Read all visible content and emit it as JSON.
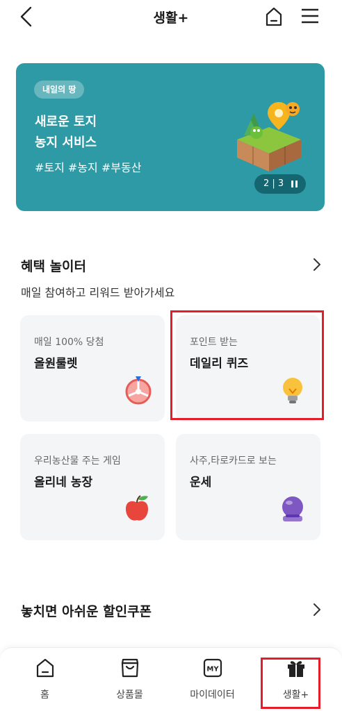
{
  "header": {
    "title": "생활+",
    "back_icon": "chevron-left-icon",
    "home_icon": "home-icon",
    "menu_icon": "hamburger-menu-icon"
  },
  "banner": {
    "badge": "내일의 땅",
    "line1": "새로운 토지",
    "line2": "농지 서비스",
    "tags": "#토지 #농지 #부동산",
    "counter": "2 | 3",
    "background_color": "#2e9aa5"
  },
  "benefits": {
    "title": "혜택 놀이터",
    "subtitle": "매일 참여하고 리워드 받아가세요",
    "cards": [
      {
        "sub": "매일 100% 당첨",
        "title": "올원룰렛",
        "icon": "roulette-icon"
      },
      {
        "sub": "포인트 받는",
        "title": "데일리 퀴즈",
        "icon": "lightbulb-icon"
      },
      {
        "sub": "우리농산물 주는 게임",
        "title": "올리네 농장",
        "icon": "apple-icon"
      },
      {
        "sub": "사주,타로카드로 보는",
        "title": "운세",
        "icon": "crystal-ball-icon"
      }
    ]
  },
  "coupons": {
    "title": "놓치면 아쉬운 할인쿠폰"
  },
  "bottom_nav": {
    "items": [
      {
        "label": "홈",
        "icon": "home-icon"
      },
      {
        "label": "상품몰",
        "icon": "shopping-bag-icon"
      },
      {
        "label": "마이데이터",
        "icon": "mydata-icon",
        "icon_text": "MY"
      },
      {
        "label": "생활+",
        "icon": "gift-icon"
      }
    ]
  },
  "colors": {
    "accent_teal": "#2e9aa5",
    "highlight_red": "#e51c2a",
    "card_background": "#f4f5f7"
  }
}
